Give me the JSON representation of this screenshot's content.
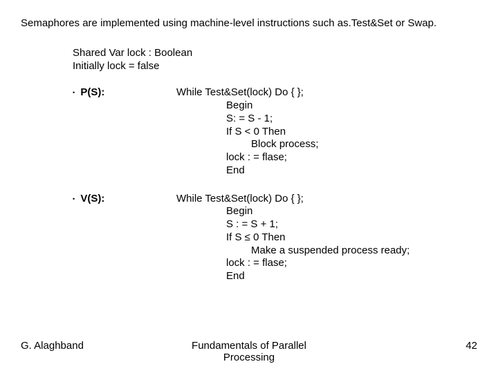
{
  "intro": "Semaphores are implemented  using machine-level instructions such as.Test&Set or Swap.",
  "decl": {
    "line1": "Shared Var  lock : Boolean",
    "line2": "Initially    lock = false"
  },
  "p": {
    "label": "P(S):",
    "while": "While Test&Set(lock)  Do  { };",
    "begin": "Begin",
    "assign": "S: = S - 1;",
    "if": "If S < 0 Then",
    "action": "Block process;",
    "lock": "lock : = flase;",
    "end": "End"
  },
  "v": {
    "label": "V(S):",
    "while": "While Test&Set(lock) Do  { };",
    "begin": "Begin",
    "assign": "S : = S + 1;",
    "if": "If S ≤ 0 Then",
    "action": "Make a suspended process ready;",
    "lock": "lock : = flase;",
    "end": "End"
  },
  "footer": {
    "left": "G. Alaghband",
    "center1": "Fundamentals of Parallel",
    "center2": "Processing",
    "right": "42"
  }
}
